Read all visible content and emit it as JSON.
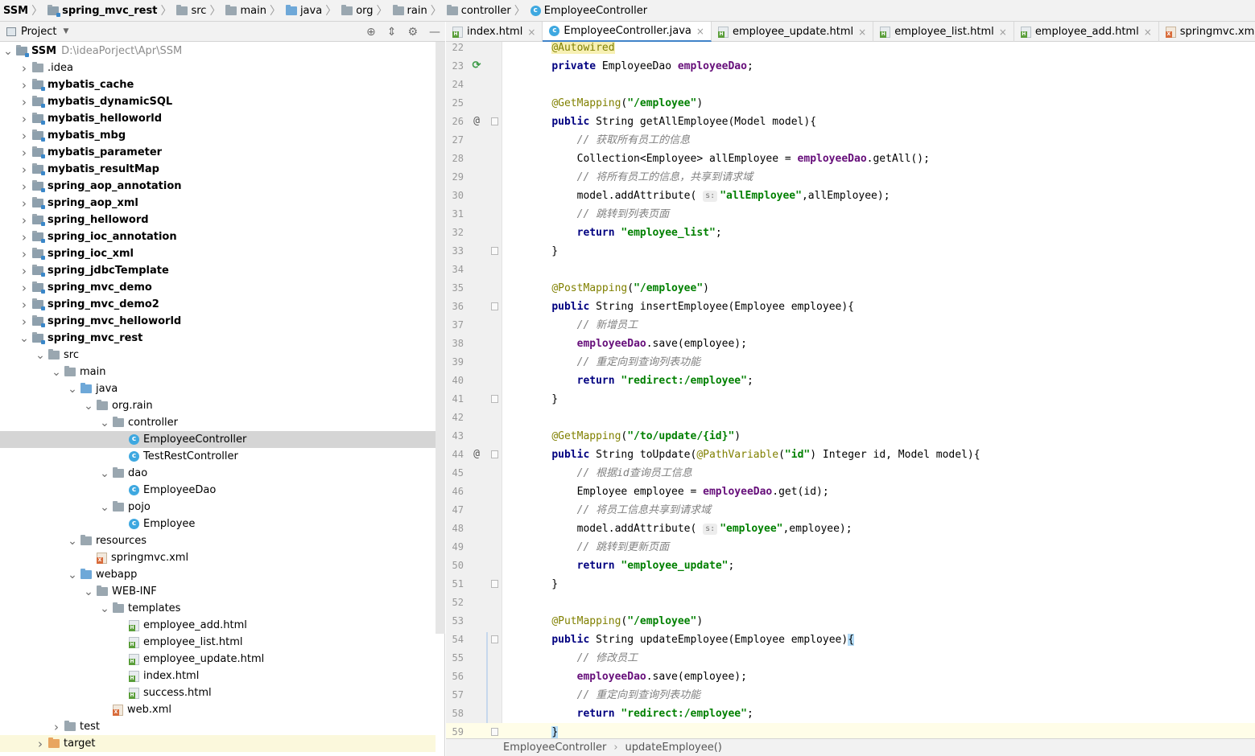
{
  "breadcrumb": {
    "items": [
      {
        "label": "SSM",
        "icon": "module-folder-icon",
        "bold": true
      },
      {
        "label": "spring_mvc_rest",
        "icon": "module-folder-icon",
        "bold": true
      },
      {
        "label": "src",
        "icon": "folder-icon",
        "bold": false
      },
      {
        "label": "main",
        "icon": "folder-icon",
        "bold": false
      },
      {
        "label": "java",
        "icon": "source-folder-icon",
        "bold": false
      },
      {
        "label": "org",
        "icon": "package-icon",
        "bold": false
      },
      {
        "label": "rain",
        "icon": "package-icon",
        "bold": false
      },
      {
        "label": "controller",
        "icon": "package-icon",
        "bold": false
      },
      {
        "label": "EmployeeController",
        "icon": "class-icon",
        "bold": false
      }
    ]
  },
  "project_panel": {
    "title": "Project",
    "tools": [
      "locate-icon",
      "collapse-all-icon",
      "gear-icon",
      "hide-icon"
    ],
    "tree": [
      {
        "label": "SSM",
        "path": "D:\\ideaPorject\\Apr\\SSM",
        "depth": 0,
        "toggle": "down",
        "icon": "module",
        "bold": true
      },
      {
        "label": ".idea",
        "depth": 1,
        "toggle": "right",
        "icon": "folder",
        "bold": false
      },
      {
        "label": "mybatis_cache",
        "depth": 1,
        "toggle": "right",
        "icon": "module",
        "bold": true
      },
      {
        "label": "mybatis_dynamicSQL",
        "depth": 1,
        "toggle": "right",
        "icon": "module",
        "bold": true
      },
      {
        "label": "mybatis_helloworld",
        "depth": 1,
        "toggle": "right",
        "icon": "module",
        "bold": true
      },
      {
        "label": "mybatis_mbg",
        "depth": 1,
        "toggle": "right",
        "icon": "module",
        "bold": true
      },
      {
        "label": "mybatis_parameter",
        "depth": 1,
        "toggle": "right",
        "icon": "module",
        "bold": true
      },
      {
        "label": "mybatis_resultMap",
        "depth": 1,
        "toggle": "right",
        "icon": "module",
        "bold": true
      },
      {
        "label": "spring_aop_annotation",
        "depth": 1,
        "toggle": "right",
        "icon": "module",
        "bold": true
      },
      {
        "label": "spring_aop_xml",
        "depth": 1,
        "toggle": "right",
        "icon": "module",
        "bold": true
      },
      {
        "label": "spring_helloword",
        "depth": 1,
        "toggle": "right",
        "icon": "module",
        "bold": true
      },
      {
        "label": "spring_ioc_annotation",
        "depth": 1,
        "toggle": "right",
        "icon": "module",
        "bold": true
      },
      {
        "label": "spring_ioc_xml",
        "depth": 1,
        "toggle": "right",
        "icon": "module",
        "bold": true
      },
      {
        "label": "spring_jdbcTemplate",
        "depth": 1,
        "toggle": "right",
        "icon": "module",
        "bold": true
      },
      {
        "label": "spring_mvc_demo",
        "depth": 1,
        "toggle": "right",
        "icon": "module",
        "bold": true
      },
      {
        "label": "spring_mvc_demo2",
        "depth": 1,
        "toggle": "right",
        "icon": "module",
        "bold": true
      },
      {
        "label": "spring_mvc_helloworld",
        "depth": 1,
        "toggle": "right",
        "icon": "module",
        "bold": true
      },
      {
        "label": "spring_mvc_rest",
        "depth": 1,
        "toggle": "down",
        "icon": "module",
        "bold": true
      },
      {
        "label": "src",
        "depth": 2,
        "toggle": "down",
        "icon": "folder",
        "bold": false
      },
      {
        "label": "main",
        "depth": 3,
        "toggle": "down",
        "icon": "folder",
        "bold": false
      },
      {
        "label": "java",
        "depth": 4,
        "toggle": "down",
        "icon": "source",
        "bold": false
      },
      {
        "label": "org.rain",
        "depth": 5,
        "toggle": "down",
        "icon": "package",
        "bold": false
      },
      {
        "label": "controller",
        "depth": 6,
        "toggle": "down",
        "icon": "package",
        "bold": false
      },
      {
        "label": "EmployeeController",
        "depth": 7,
        "toggle": "",
        "icon": "class",
        "bold": false,
        "selected": true
      },
      {
        "label": "TestRestController",
        "depth": 7,
        "toggle": "",
        "icon": "class",
        "bold": false
      },
      {
        "label": "dao",
        "depth": 6,
        "toggle": "down",
        "icon": "package",
        "bold": false
      },
      {
        "label": "EmployeeDao",
        "depth": 7,
        "toggle": "",
        "icon": "class",
        "bold": false
      },
      {
        "label": "pojo",
        "depth": 6,
        "toggle": "down",
        "icon": "package",
        "bold": false
      },
      {
        "label": "Employee",
        "depth": 7,
        "toggle": "",
        "icon": "class",
        "bold": false
      },
      {
        "label": "resources",
        "depth": 4,
        "toggle": "down",
        "icon": "resources",
        "bold": false
      },
      {
        "label": "springmvc.xml",
        "depth": 5,
        "toggle": "",
        "icon": "xml",
        "bold": false
      },
      {
        "label": "webapp",
        "depth": 4,
        "toggle": "down",
        "icon": "webapp",
        "bold": false
      },
      {
        "label": "WEB-INF",
        "depth": 5,
        "toggle": "down",
        "icon": "folder",
        "bold": false
      },
      {
        "label": "templates",
        "depth": 6,
        "toggle": "down",
        "icon": "folder",
        "bold": false
      },
      {
        "label": "employee_add.html",
        "depth": 7,
        "toggle": "",
        "icon": "html",
        "bold": false
      },
      {
        "label": "employee_list.html",
        "depth": 7,
        "toggle": "",
        "icon": "html",
        "bold": false
      },
      {
        "label": "employee_update.html",
        "depth": 7,
        "toggle": "",
        "icon": "html",
        "bold": false
      },
      {
        "label": "index.html",
        "depth": 7,
        "toggle": "",
        "icon": "html",
        "bold": false
      },
      {
        "label": "success.html",
        "depth": 7,
        "toggle": "",
        "icon": "html",
        "bold": false
      },
      {
        "label": "web.xml",
        "depth": 6,
        "toggle": "",
        "icon": "xml",
        "bold": false
      },
      {
        "label": "test",
        "depth": 3,
        "toggle": "right",
        "icon": "folder",
        "bold": false
      },
      {
        "label": "target",
        "depth": 2,
        "toggle": "right",
        "icon": "target",
        "bold": false,
        "target": true
      }
    ]
  },
  "tabs": [
    {
      "label": "index.html",
      "icon": "html",
      "active": false
    },
    {
      "label": "EmployeeController.java",
      "icon": "class",
      "active": true
    },
    {
      "label": "employee_update.html",
      "icon": "html",
      "active": false
    },
    {
      "label": "employee_list.html",
      "icon": "html",
      "active": false
    },
    {
      "label": "employee_add.html",
      "icon": "html",
      "active": false
    },
    {
      "label": "springmvc.xml",
      "icon": "xml",
      "active": false
    }
  ],
  "editor": {
    "lines": [
      {
        "n": "22",
        "gutter": "",
        "fold": false,
        "tokens": [
          [
            "    ",
            ""
          ],
          [
            "@Autowired",
            "ann hl"
          ]
        ]
      },
      {
        "n": "23",
        "gutter": "bean",
        "fold": false,
        "tokens": [
          [
            "    ",
            ""
          ],
          [
            "private",
            "kw"
          ],
          [
            " EmployeeDao ",
            ""
          ],
          [
            "employeeDao",
            "fld"
          ],
          [
            ";",
            ""
          ]
        ]
      },
      {
        "n": "24",
        "gutter": "",
        "fold": false,
        "tokens": []
      },
      {
        "n": "25",
        "gutter": "",
        "fold": false,
        "tokens": [
          [
            "    ",
            ""
          ],
          [
            "@GetMapping",
            "ann"
          ],
          [
            "(",
            ""
          ],
          [
            "\"/employee\"",
            "str"
          ],
          [
            ")",
            ""
          ]
        ]
      },
      {
        "n": "26",
        "gutter": "@",
        "fold": true,
        "tokens": [
          [
            "    ",
            ""
          ],
          [
            "public",
            "kw"
          ],
          [
            " String getAllEmployee(Model model){",
            ""
          ]
        ]
      },
      {
        "n": "27",
        "gutter": "",
        "fold": false,
        "tokens": [
          [
            "        ",
            ""
          ],
          [
            "// 获取所有员工的信息",
            "cmt"
          ]
        ]
      },
      {
        "n": "28",
        "gutter": "",
        "fold": false,
        "tokens": [
          [
            "        Collection<Employee> allEmployee = ",
            ""
          ],
          [
            "employeeDao",
            "fld"
          ],
          [
            ".getAll();",
            ""
          ]
        ]
      },
      {
        "n": "29",
        "gutter": "",
        "fold": false,
        "tokens": [
          [
            "        ",
            ""
          ],
          [
            "// 将所有员工的信息，共享到请求域",
            "cmt"
          ]
        ]
      },
      {
        "n": "30",
        "gutter": "",
        "fold": false,
        "tokens": [
          [
            "        model.addAttribute( ",
            ""
          ],
          [
            "s:",
            "hint"
          ],
          [
            "\"allEmployee\"",
            "str"
          ],
          [
            ",allEmployee);",
            ""
          ]
        ]
      },
      {
        "n": "31",
        "gutter": "",
        "fold": false,
        "tokens": [
          [
            "        ",
            ""
          ],
          [
            "// 跳转到列表页面",
            "cmt"
          ]
        ]
      },
      {
        "n": "32",
        "gutter": "",
        "fold": false,
        "tokens": [
          [
            "        ",
            ""
          ],
          [
            "return",
            "kw"
          ],
          [
            " ",
            ""
          ],
          [
            "\"employee_list\"",
            "str"
          ],
          [
            ";",
            ""
          ]
        ]
      },
      {
        "n": "33",
        "gutter": "",
        "fold": true,
        "tokens": [
          [
            "    }",
            ""
          ]
        ]
      },
      {
        "n": "34",
        "gutter": "",
        "fold": false,
        "tokens": []
      },
      {
        "n": "35",
        "gutter": "",
        "fold": false,
        "tokens": [
          [
            "    ",
            ""
          ],
          [
            "@PostMapping",
            "ann"
          ],
          [
            "(",
            ""
          ],
          [
            "\"/employee\"",
            "str"
          ],
          [
            ")",
            ""
          ]
        ]
      },
      {
        "n": "36",
        "gutter": "",
        "fold": true,
        "tokens": [
          [
            "    ",
            ""
          ],
          [
            "public",
            "kw"
          ],
          [
            " String insertEmployee(Employee employee){",
            ""
          ]
        ]
      },
      {
        "n": "37",
        "gutter": "",
        "fold": false,
        "tokens": [
          [
            "        ",
            ""
          ],
          [
            "// 新增员工",
            "cmt"
          ]
        ]
      },
      {
        "n": "38",
        "gutter": "",
        "fold": false,
        "tokens": [
          [
            "        ",
            ""
          ],
          [
            "employeeDao",
            "fld"
          ],
          [
            ".save(employee);",
            ""
          ]
        ]
      },
      {
        "n": "39",
        "gutter": "",
        "fold": false,
        "tokens": [
          [
            "        ",
            ""
          ],
          [
            "// 重定向到查询列表功能",
            "cmt"
          ]
        ]
      },
      {
        "n": "40",
        "gutter": "",
        "fold": false,
        "tokens": [
          [
            "        ",
            ""
          ],
          [
            "return",
            "kw"
          ],
          [
            " ",
            ""
          ],
          [
            "\"redirect:/employee\"",
            "str"
          ],
          [
            ";",
            ""
          ]
        ]
      },
      {
        "n": "41",
        "gutter": "",
        "fold": true,
        "tokens": [
          [
            "    }",
            ""
          ]
        ]
      },
      {
        "n": "42",
        "gutter": "",
        "fold": false,
        "tokens": []
      },
      {
        "n": "43",
        "gutter": "",
        "fold": false,
        "tokens": [
          [
            "    ",
            ""
          ],
          [
            "@GetMapping",
            "ann"
          ],
          [
            "(",
            ""
          ],
          [
            "\"/to/update/{id}\"",
            "str"
          ],
          [
            ")",
            ""
          ]
        ]
      },
      {
        "n": "44",
        "gutter": "@",
        "fold": true,
        "tokens": [
          [
            "    ",
            ""
          ],
          [
            "public",
            "kw"
          ],
          [
            " String toUpdate(",
            ""
          ],
          [
            "@PathVariable",
            "ann"
          ],
          [
            "(",
            ""
          ],
          [
            "\"id\"",
            "str"
          ],
          [
            ") Integer id, Model model){",
            ""
          ]
        ]
      },
      {
        "n": "45",
        "gutter": "",
        "fold": false,
        "tokens": [
          [
            "        ",
            ""
          ],
          [
            "// 根据id查询员工信息",
            "cmt"
          ]
        ]
      },
      {
        "n": "46",
        "gutter": "",
        "fold": false,
        "tokens": [
          [
            "        Employee employee = ",
            ""
          ],
          [
            "employeeDao",
            "fld"
          ],
          [
            ".get(id);",
            ""
          ]
        ]
      },
      {
        "n": "47",
        "gutter": "",
        "fold": false,
        "tokens": [
          [
            "        ",
            ""
          ],
          [
            "// 将员工信息共享到请求域",
            "cmt"
          ]
        ]
      },
      {
        "n": "48",
        "gutter": "",
        "fold": false,
        "tokens": [
          [
            "        model.addAttribute( ",
            ""
          ],
          [
            "s:",
            "hint"
          ],
          [
            "\"employee\"",
            "str"
          ],
          [
            ",employee);",
            ""
          ]
        ]
      },
      {
        "n": "49",
        "gutter": "",
        "fold": false,
        "tokens": [
          [
            "        ",
            ""
          ],
          [
            "// 跳转到更新页面",
            "cmt"
          ]
        ]
      },
      {
        "n": "50",
        "gutter": "",
        "fold": false,
        "tokens": [
          [
            "        ",
            ""
          ],
          [
            "return",
            "kw"
          ],
          [
            " ",
            ""
          ],
          [
            "\"employee_update\"",
            "str"
          ],
          [
            ";",
            ""
          ]
        ]
      },
      {
        "n": "51",
        "gutter": "",
        "fold": true,
        "tokens": [
          [
            "    }",
            ""
          ]
        ]
      },
      {
        "n": "52",
        "gutter": "",
        "fold": false,
        "tokens": []
      },
      {
        "n": "53",
        "gutter": "",
        "fold": false,
        "tokens": [
          [
            "    ",
            ""
          ],
          [
            "@PutMapping",
            "ann"
          ],
          [
            "(",
            ""
          ],
          [
            "\"/employee\"",
            "str"
          ],
          [
            ")",
            ""
          ]
        ]
      },
      {
        "n": "54",
        "gutter": "",
        "fold": true,
        "tokens": [
          [
            "    ",
            ""
          ],
          [
            "public",
            "kw"
          ],
          [
            " String updateEmployee(Employee employee)",
            ""
          ],
          [
            "{",
            "brace-hl"
          ]
        ]
      },
      {
        "n": "55",
        "gutter": "",
        "fold": false,
        "tokens": [
          [
            "        ",
            ""
          ],
          [
            "// 修改员工",
            "cmt"
          ]
        ]
      },
      {
        "n": "56",
        "gutter": "",
        "fold": false,
        "tokens": [
          [
            "        ",
            ""
          ],
          [
            "employeeDao",
            "fld"
          ],
          [
            ".save(employee);",
            ""
          ]
        ]
      },
      {
        "n": "57",
        "gutter": "",
        "fold": false,
        "tokens": [
          [
            "        ",
            ""
          ],
          [
            "// 重定向到查询列表功能",
            "cmt"
          ]
        ]
      },
      {
        "n": "58",
        "gutter": "",
        "fold": false,
        "tokens": [
          [
            "        ",
            ""
          ],
          [
            "return",
            "kw"
          ],
          [
            " ",
            ""
          ],
          [
            "\"redirect:/employee\"",
            "str"
          ],
          [
            ";",
            ""
          ]
        ]
      },
      {
        "n": "59",
        "gutter": "",
        "fold": true,
        "current": true,
        "tokens": [
          [
            "    ",
            ""
          ],
          [
            "}",
            "brace-hl"
          ]
        ]
      }
    ]
  },
  "editor_breadcrumb": {
    "class_name": "EmployeeController",
    "method_name": "updateEmployee()"
  }
}
